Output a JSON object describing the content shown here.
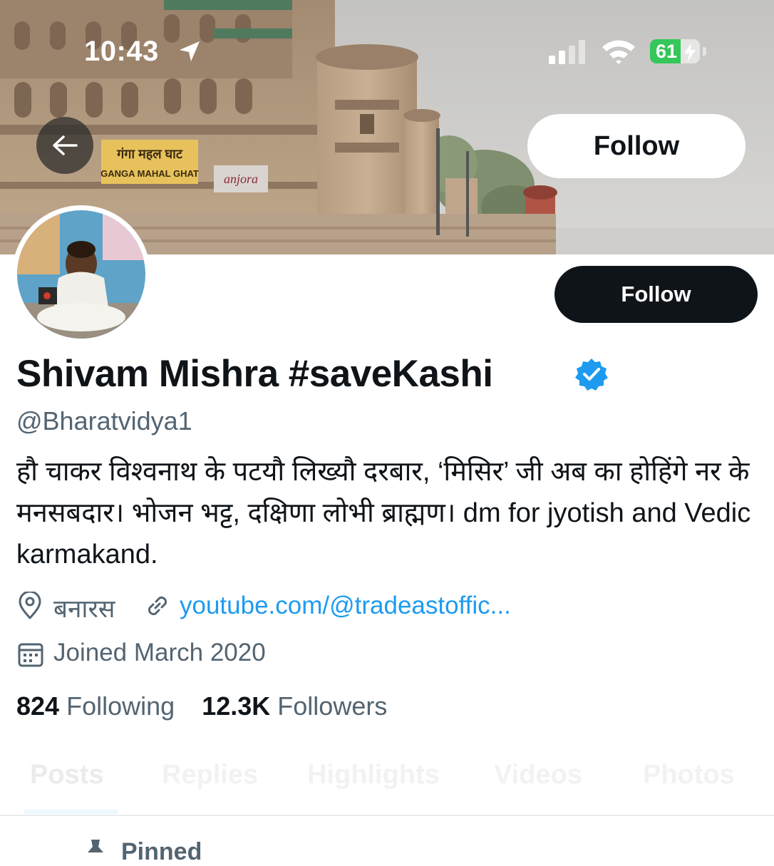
{
  "status_bar": {
    "time": "10:43",
    "battery_level": "61",
    "battery_fraction": 0.61,
    "location_icon": "location-arrow-icon",
    "signal_icon": "cellular-signal-icon",
    "wifi_icon": "wifi-icon",
    "charging_icon": "bolt-icon"
  },
  "banner": {
    "sign_hindi": "गंगा महल घाट",
    "sign_english": "GANGA MAHAL GHAT",
    "sign_shop": "anjora",
    "back_icon": "arrow-left-icon",
    "follow_label": "Follow"
  },
  "profile": {
    "follow_label": "Follow",
    "display_name": "Shivam Mishra #saveKashi",
    "verified_icon": "verified-badge-icon",
    "handle": "@Bharatvidya1",
    "bio": "हौ चाकर विश्वनाथ के पटयौ लिख्यौ दरबार, ‘मिसिर’ जी अब का होहिंगे नर के मनसबदार। भोजन भट्ट, दक्षिणा लोभी ब्राह्मण। dm for jyotish and Vedic karmakand.",
    "location": "बनारस",
    "website": "youtube.com/@tradeastoffic...",
    "joined": "Joined March 2020",
    "following_count": "824",
    "following_label": "Following",
    "followers_count": "12.3K",
    "followers_label": "Followers"
  },
  "tabs": [
    {
      "label": "Posts"
    },
    {
      "label": "Replies"
    },
    {
      "label": "Highlights"
    },
    {
      "label": "Videos"
    },
    {
      "label": "Photos"
    }
  ],
  "pinned": {
    "label": "Pinned"
  },
  "colors": {
    "accent": "#1d9bf0",
    "text": "#0f1419",
    "secondary_text": "#536471",
    "battery_green": "#35c759"
  }
}
